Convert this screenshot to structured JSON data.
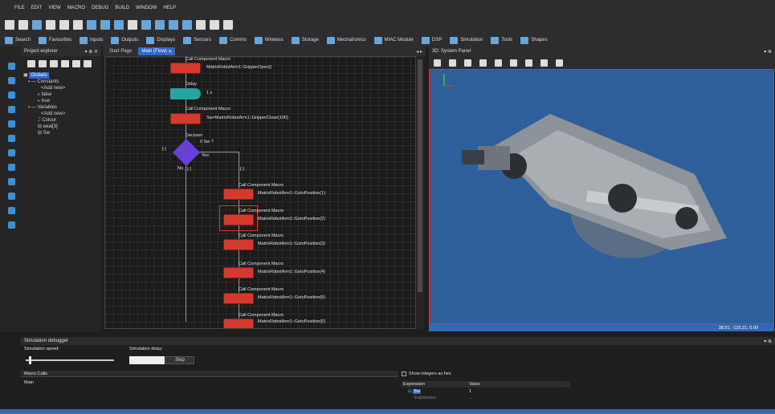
{
  "menu": [
    "FILE",
    "EDIT",
    "VIEW",
    "MACRO",
    "DEBUG",
    "BUILD",
    "WINDOW",
    "HELP"
  ],
  "toolbar2": [
    {
      "icon": "search-icon",
      "label": "Search"
    },
    {
      "icon": "star-icon",
      "label": "Favourites"
    },
    {
      "icon": "inputs-icon",
      "label": "Inputs"
    },
    {
      "icon": "outputs-icon",
      "label": "Outputs"
    },
    {
      "icon": "displays-icon",
      "label": "Displays"
    },
    {
      "icon": "sensors-icon",
      "label": "Sensors"
    },
    {
      "icon": "comms-icon",
      "label": "Comms"
    },
    {
      "icon": "wireless-icon",
      "label": "Wireless"
    },
    {
      "icon": "storage-icon",
      "label": "Storage"
    },
    {
      "icon": "mechatronics-icon",
      "label": "Mechatronics"
    },
    {
      "icon": "miac-icon",
      "label": "MIAC Module"
    },
    {
      "icon": "dsp-icon",
      "label": "DSP"
    },
    {
      "icon": "simulation-icon",
      "label": "Simulation"
    },
    {
      "icon": "tools-icon",
      "label": "Tools"
    },
    {
      "icon": "shapes-icon",
      "label": "Shapes"
    }
  ],
  "project": {
    "title": "Project explorer",
    "pin": "▾ ⊕ ✕",
    "globals": "Globals",
    "constants": "Constants",
    "add_new_1": "<Add new>",
    "c_false": "false",
    "c_true": "true",
    "variables": "Variables",
    "add_new_2": "<Add new>",
    "v_colour": "Colour",
    "v_eeai": "eeai[3]",
    "v_sw": "Sw"
  },
  "tabs": {
    "start": "Start Page",
    "main": "Main (Flow)",
    "close": "✕",
    "nav": "◂ ▸"
  },
  "flow": {
    "cc_top": "Call Component Macro",
    "cc_top_call": "MatrixRobotArm1::GripperOpen()",
    "delay_label": "Delay",
    "delay_val": "1 s",
    "cc2": "Call Component Macro",
    "cc2_call": "Sw=MatrixRobotArm1::GripperClose(100)",
    "decision": "Decision",
    "decision_cond": "If Sw ?",
    "yes": "Yes",
    "no": "No",
    "bracket_left": "[-]",
    "bracket_no": "[-]",
    "bracket_yes": "[-]",
    "calls": [
      {
        "label": "Call Component Macro",
        "call": "MatrixRobotArm1::GotoPosition(1)"
      },
      {
        "label": "Call Component Macro",
        "call": "MatrixRobotArm1::GotoPosition(2)"
      },
      {
        "label": "Call Component Macro",
        "call": "MatrixRobotArm1::GotoPosition(3)"
      },
      {
        "label": "Call Component Macro",
        "call": "MatrixRobotArm1::GotoPosition(4)"
      },
      {
        "label": "Call Component Macro",
        "call": "MatrixRobotArm1::GotoPosition(5)"
      },
      {
        "label": "Call Component Macro",
        "call": "MatrixRobotArm1::GotoPosition(6)"
      }
    ]
  },
  "panel3d": {
    "title": "3D: System Panel",
    "pin": "▾ ⊕",
    "coords": "38.91, -122.21, 0.00"
  },
  "debugger": {
    "title": "Simulation debugger",
    "pin": "▾ ⊕",
    "speed_label": "Simulation speed:",
    "delay_label": "Simulation delay:",
    "skip": "Skip",
    "macro_calls": "Macro Calls",
    "main": "Main",
    "show_hex": "Show integers as hex",
    "col_expression": "Expression",
    "col_value": "Value",
    "row_name": "Sw",
    "row_value": "1",
    "row_expr": "Expression",
    "row_expr_val": "..."
  },
  "colors": {
    "accent": "#3366cc",
    "flow_red": "#d63a2f",
    "flow_teal": "#27a3a3",
    "flow_purple": "#6a3fd8",
    "view_bg": "#2e5f9a"
  }
}
